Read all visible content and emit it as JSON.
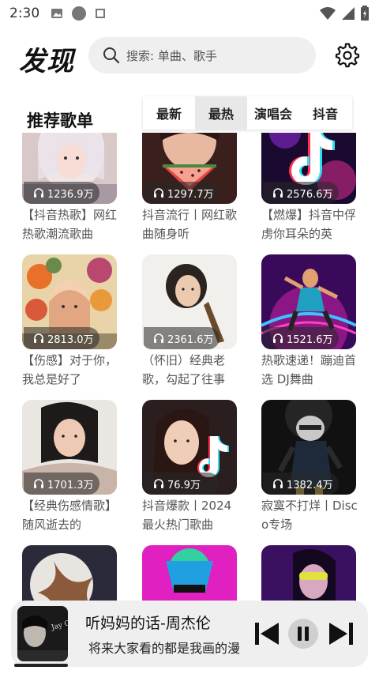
{
  "status": {
    "time": "2:30"
  },
  "header": {
    "brand": "发现",
    "search_placeholder": "搜索: 单曲、歌手"
  },
  "section": {
    "title": "推荐歌单"
  },
  "tabs": [
    {
      "label": "最新",
      "active": false
    },
    {
      "label": "最热",
      "active": true
    },
    {
      "label": "演唱会",
      "active": false
    },
    {
      "label": "抖音",
      "active": false
    }
  ],
  "playlists": [
    {
      "plays": "1236.9万",
      "title": "【抖音热歌】网红热歌潮流歌曲"
    },
    {
      "plays": "1297.7万",
      "title": "抖音流行丨网红歌曲随身听"
    },
    {
      "plays": "2576.6万",
      "title": "【燃爆】抖音中俘虏你耳朵的英"
    },
    {
      "plays": "2813.0万",
      "title": "【伤感】对于你，我总是好了"
    },
    {
      "plays": "2361.6万",
      "title": "（怀旧）经典老歌，勾起了往事"
    },
    {
      "plays": "1521.6万",
      "title": "热歌速递！蹦迪首选 DJ舞曲"
    },
    {
      "plays": "1701.3万",
      "title": "【经典伤感情歌】随风逝去的"
    },
    {
      "plays": "76.9万",
      "title": "抖音爆款丨2024最火热门歌曲"
    },
    {
      "plays": "1382.4万",
      "title": "寂寞不打烊丨Disco专场"
    },
    {
      "plays": "",
      "title": ""
    },
    {
      "plays": "",
      "title": ""
    },
    {
      "plays": "",
      "title": ""
    }
  ],
  "player": {
    "title": "听妈妈的话-周杰伦",
    "subtitle": "将来大家看的都是我画的漫",
    "cover_text": "Jay Chou"
  },
  "colors": {
    "accent": "#111111",
    "player_bg": "#efefef",
    "tab_active": "#e8e8e8"
  }
}
